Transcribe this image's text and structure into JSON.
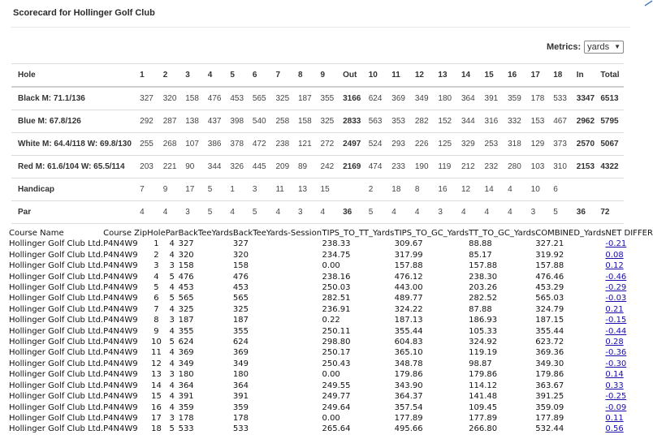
{
  "title": "Scorecard for Hollinger Golf Club",
  "metrics": {
    "label": "Metrics:",
    "selected": "yards"
  },
  "scorecard": {
    "header": [
      "Hole",
      "1",
      "2",
      "3",
      "4",
      "5",
      "6",
      "7",
      "8",
      "9",
      "Out",
      "10",
      "11",
      "12",
      "13",
      "14",
      "15",
      "16",
      "17",
      "18",
      "In",
      "Total"
    ],
    "rows": [
      {
        "label": "Black M: 71.1/136",
        "cells": [
          "327",
          "320",
          "158",
          "476",
          "453",
          "565",
          "325",
          "187",
          "355",
          "3166",
          "624",
          "369",
          "349",
          "180",
          "364",
          "391",
          "359",
          "178",
          "533",
          "3347",
          "6513"
        ]
      },
      {
        "label": "Blue M: 67.8/126",
        "cells": [
          "292",
          "287",
          "138",
          "437",
          "398",
          "540",
          "258",
          "158",
          "325",
          "2833",
          "563",
          "353",
          "282",
          "152",
          "344",
          "316",
          "332",
          "153",
          "467",
          "2962",
          "5795"
        ]
      },
      {
        "label": "White M: 64.4/118 W: 69.8/130",
        "cells": [
          "255",
          "268",
          "107",
          "386",
          "378",
          "472",
          "238",
          "121",
          "272",
          "2497",
          "524",
          "293",
          "226",
          "125",
          "329",
          "253",
          "318",
          "129",
          "373",
          "2570",
          "5067"
        ]
      },
      {
        "label": "Red M: 61.6/104 W: 65.5/114",
        "cells": [
          "203",
          "221",
          "90",
          "344",
          "326",
          "445",
          "209",
          "89",
          "242",
          "2169",
          "474",
          "233",
          "190",
          "119",
          "212",
          "232",
          "280",
          "103",
          "310",
          "2153",
          "4322"
        ]
      },
      {
        "label": "Handicap",
        "cells": [
          "7",
          "9",
          "17",
          "5",
          "1",
          "3",
          "11",
          "13",
          "15",
          "",
          "2",
          "18",
          "8",
          "16",
          "12",
          "14",
          "4",
          "10",
          "6",
          "",
          ""
        ]
      },
      {
        "label": "Par",
        "cells": [
          "4",
          "4",
          "3",
          "5",
          "4",
          "5",
          "4",
          "3",
          "4",
          "36",
          "5",
          "4",
          "4",
          "3",
          "4",
          "4",
          "4",
          "3",
          "5",
          "36",
          "72"
        ]
      }
    ]
  },
  "data_table": {
    "headers": [
      "Course Name",
      "Course Zip",
      "Hole",
      "Par",
      "BackTeeYards",
      "BackTeeYards-Session",
      "TIPS_TO_TT_Yards",
      "TIPS_TO_GC_Yards",
      "TT_TO_GC_Yards",
      "COMBINED_Yards",
      "NET DIFFER"
    ],
    "rows": [
      [
        "Hollinger Golf Club Ltd.",
        "P4N4W9",
        "1",
        "4",
        "327",
        "327",
        "238.33",
        "309.67",
        "88.88",
        "327.21",
        "-0.21"
      ],
      [
        "Hollinger Golf Club Ltd.",
        "P4N4W9",
        "2",
        "4",
        "320",
        "320",
        "234.75",
        "317.99",
        "85.17",
        "319.92",
        "0.08"
      ],
      [
        "Hollinger Golf Club Ltd.",
        "P4N4W9",
        "3",
        "3",
        "158",
        "158",
        "0.00",
        "157.88",
        "157.88",
        "157.88",
        "0.12"
      ],
      [
        "Hollinger Golf Club Ltd.",
        "P4N4W9",
        "4",
        "5",
        "476",
        "476",
        "238.16",
        "476.12",
        "238.30",
        "476.46",
        "-0.46"
      ],
      [
        "Hollinger Golf Club Ltd.",
        "P4N4W9",
        "5",
        "4",
        "453",
        "453",
        "250.03",
        "443.00",
        "203.26",
        "453.29",
        "-0.29"
      ],
      [
        "Hollinger Golf Club Ltd.",
        "P4N4W9",
        "6",
        "5",
        "565",
        "565",
        "282.51",
        "489.77",
        "282.52",
        "565.03",
        "-0.03"
      ],
      [
        "Hollinger Golf Club Ltd.",
        "P4N4W9",
        "7",
        "4",
        "325",
        "325",
        "236.91",
        "324.22",
        "87.88",
        "324.79",
        "0.21"
      ],
      [
        "Hollinger Golf Club Ltd.",
        "P4N4W9",
        "8",
        "3",
        "187",
        "187",
        "0.22",
        "187.13",
        "186.93",
        "187.15",
        "-0.15"
      ],
      [
        "Hollinger Golf Club Ltd.",
        "P4N4W9",
        "9",
        "4",
        "355",
        "355",
        "250.11",
        "355.44",
        "105.33",
        "355.44",
        "-0.44"
      ],
      [
        "Hollinger Golf Club Ltd.",
        "P4N4W9",
        "10",
        "5",
        "624",
        "624",
        "298.80",
        "604.83",
        "324.92",
        "623.72",
        "0.28"
      ],
      [
        "Hollinger Golf Club Ltd.",
        "P4N4W9",
        "11",
        "4",
        "369",
        "369",
        "250.17",
        "365.10",
        "119.19",
        "369.36",
        "-0.36"
      ],
      [
        "Hollinger Golf Club Ltd.",
        "P4N4W9",
        "12",
        "4",
        "349",
        "349",
        "250.43",
        "348.78",
        "98.87",
        "349.30",
        "-0.30"
      ],
      [
        "Hollinger Golf Club Ltd.",
        "P4N4W9",
        "13",
        "3",
        "180",
        "180",
        "0.00",
        "179.86",
        "179.86",
        "179.86",
        "0.14"
      ],
      [
        "Hollinger Golf Club Ltd.",
        "P4N4W9",
        "14",
        "4",
        "364",
        "364",
        "249.55",
        "343.90",
        "114.12",
        "363.67",
        "0.33"
      ],
      [
        "Hollinger Golf Club Ltd.",
        "P4N4W9",
        "15",
        "4",
        "391",
        "391",
        "249.77",
        "364.37",
        "141.48",
        "391.25",
        "-0.25"
      ],
      [
        "Hollinger Golf Club Ltd.",
        "P4N4W9",
        "16",
        "4",
        "359",
        "359",
        "249.64",
        "357.54",
        "109.45",
        "359.09",
        "-0.09"
      ],
      [
        "Hollinger Golf Club Ltd.",
        "P4N4W9",
        "17",
        "3",
        "178",
        "178",
        "0.00",
        "177.89",
        "177.89",
        "177.89",
        "0.11"
      ],
      [
        "Hollinger Golf Club Ltd.",
        "P4N4W9",
        "18",
        "5",
        "533",
        "533",
        "265.64",
        "495.66",
        "266.80",
        "532.44",
        "0.56"
      ]
    ]
  },
  "colors": {
    "link": "#1a0dab",
    "corner_accent": "#4a7fc1"
  },
  "icons": {
    "select": "chevron-down-icon",
    "corner": "corner-accent-icon"
  }
}
